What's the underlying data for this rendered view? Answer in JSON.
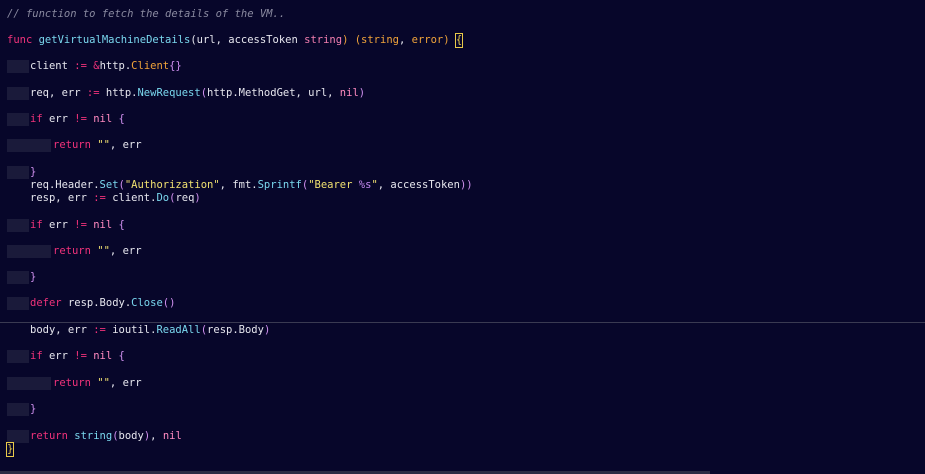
{
  "editor": {
    "colors": {
      "background": "#07062a",
      "keyword": "#f0327a",
      "function": "#7ad8ef",
      "string": "#f0e070",
      "comment": "#8a8aa0",
      "type": "#f0a33a"
    },
    "lines": [
      {
        "id": "l1",
        "tokens": [
          {
            "t": "// function to fetch the details of the VM..",
            "c": "comment"
          }
        ]
      },
      {
        "id": "l2",
        "tokens": [
          {
            "t": "func ",
            "c": "kw"
          },
          {
            "t": "getVirtualMachineDetails",
            "c": "fn"
          },
          {
            "t": "(url, accessToken ",
            "c": "plain"
          },
          {
            "t": "string",
            "c": "type"
          },
          {
            "t": ") (",
            "c": "type2"
          },
          {
            "t": "string",
            "c": "type2"
          },
          {
            "t": ", ",
            "c": "plain"
          },
          {
            "t": "error",
            "c": "type2"
          },
          {
            "t": ") ",
            "c": "type2"
          },
          {
            "t": "{",
            "c": "bracket"
          }
        ]
      },
      {
        "id": "l3",
        "tokens": [
          {
            "t": "client ",
            "c": "plain"
          },
          {
            "t": ":= &",
            "c": "op"
          },
          {
            "t": "http.",
            "c": "plain"
          },
          {
            "t": "Client",
            "c": "type2"
          },
          {
            "t": "{}",
            "c": "paren"
          }
        ]
      },
      {
        "id": "l4",
        "tokens": [
          {
            "t": "req, err ",
            "c": "plain"
          },
          {
            "t": ":= ",
            "c": "op"
          },
          {
            "t": "http.",
            "c": "plain"
          },
          {
            "t": "NewRequest",
            "c": "fn"
          },
          {
            "t": "(",
            "c": "paren"
          },
          {
            "t": "http.MethodGet, url, ",
            "c": "plain"
          },
          {
            "t": "nil",
            "c": "nil"
          },
          {
            "t": ")",
            "c": "paren"
          }
        ]
      },
      {
        "id": "l5",
        "tokens": [
          {
            "t": "if ",
            "c": "kw"
          },
          {
            "t": "err ",
            "c": "plain"
          },
          {
            "t": "!= ",
            "c": "op"
          },
          {
            "t": "nil ",
            "c": "nil"
          },
          {
            "t": "{",
            "c": "paren"
          }
        ]
      },
      {
        "id": "l6",
        "tokens": [
          {
            "t": "return ",
            "c": "kw"
          },
          {
            "t": "\"\"",
            "c": "str"
          },
          {
            "t": ", err",
            "c": "plain"
          }
        ]
      },
      {
        "id": "l7",
        "tokens": [
          {
            "t": "}",
            "c": "paren"
          }
        ]
      },
      {
        "id": "l8",
        "tokens": [
          {
            "t": "req.Header.",
            "c": "plain"
          },
          {
            "t": "Set",
            "c": "fn"
          },
          {
            "t": "(",
            "c": "paren"
          },
          {
            "t": "\"Authorization\"",
            "c": "str"
          },
          {
            "t": ", fmt.",
            "c": "plain"
          },
          {
            "t": "Sprintf",
            "c": "fn"
          },
          {
            "t": "(",
            "c": "paren"
          },
          {
            "t": "\"Bearer ",
            "c": "str"
          },
          {
            "t": "%s",
            "c": "fmt"
          },
          {
            "t": "\"",
            "c": "str"
          },
          {
            "t": ", accessToken",
            "c": "plain"
          },
          {
            "t": "))",
            "c": "paren"
          }
        ]
      },
      {
        "id": "l9",
        "tokens": [
          {
            "t": "resp, err ",
            "c": "plain"
          },
          {
            "t": ":= ",
            "c": "op"
          },
          {
            "t": "client.",
            "c": "plain"
          },
          {
            "t": "Do",
            "c": "fn"
          },
          {
            "t": "(",
            "c": "paren"
          },
          {
            "t": "req",
            "c": "plain"
          },
          {
            "t": ")",
            "c": "paren"
          }
        ]
      },
      {
        "id": "l10",
        "tokens": [
          {
            "t": "if ",
            "c": "kw"
          },
          {
            "t": "err ",
            "c": "plain"
          },
          {
            "t": "!= ",
            "c": "op"
          },
          {
            "t": "nil ",
            "c": "nil"
          },
          {
            "t": "{",
            "c": "paren"
          }
        ]
      },
      {
        "id": "l11",
        "tokens": [
          {
            "t": "return ",
            "c": "kw"
          },
          {
            "t": "\"\"",
            "c": "str"
          },
          {
            "t": ", err",
            "c": "plain"
          }
        ]
      },
      {
        "id": "l12",
        "tokens": [
          {
            "t": "}",
            "c": "paren"
          }
        ]
      },
      {
        "id": "l13",
        "tokens": [
          {
            "t": "defer ",
            "c": "kw"
          },
          {
            "t": "resp.Body.",
            "c": "plain"
          },
          {
            "t": "Close",
            "c": "fn"
          },
          {
            "t": "()",
            "c": "paren"
          }
        ]
      },
      {
        "id": "l14",
        "tokens": [
          {
            "t": "body, err ",
            "c": "plain"
          },
          {
            "t": ":= ",
            "c": "op"
          },
          {
            "t": "ioutil.",
            "c": "plain"
          },
          {
            "t": "ReadAll",
            "c": "fn"
          },
          {
            "t": "(",
            "c": "paren"
          },
          {
            "t": "resp.Body",
            "c": "plain"
          },
          {
            "t": ")",
            "c": "paren"
          }
        ]
      },
      {
        "id": "l15",
        "tokens": [
          {
            "t": "if ",
            "c": "kw"
          },
          {
            "t": "err ",
            "c": "plain"
          },
          {
            "t": "!= ",
            "c": "op"
          },
          {
            "t": "nil ",
            "c": "nil"
          },
          {
            "t": "{",
            "c": "paren"
          }
        ]
      },
      {
        "id": "l16",
        "tokens": [
          {
            "t": "return ",
            "c": "kw"
          },
          {
            "t": "\"\"",
            "c": "str"
          },
          {
            "t": ", err",
            "c": "plain"
          }
        ]
      },
      {
        "id": "l17",
        "tokens": [
          {
            "t": "}",
            "c": "paren"
          }
        ]
      },
      {
        "id": "l18",
        "tokens": [
          {
            "t": "return ",
            "c": "kw"
          },
          {
            "t": "string",
            "c": "fn"
          },
          {
            "t": "(",
            "c": "paren"
          },
          {
            "t": "body",
            "c": "plain"
          },
          {
            "t": ")",
            "c": "paren"
          },
          {
            "t": ", ",
            "c": "plain"
          },
          {
            "t": "nil",
            "c": "nil"
          }
        ]
      },
      {
        "id": "l19",
        "tokens": [
          {
            "t": "}",
            "c": "bracket"
          }
        ]
      }
    ]
  }
}
